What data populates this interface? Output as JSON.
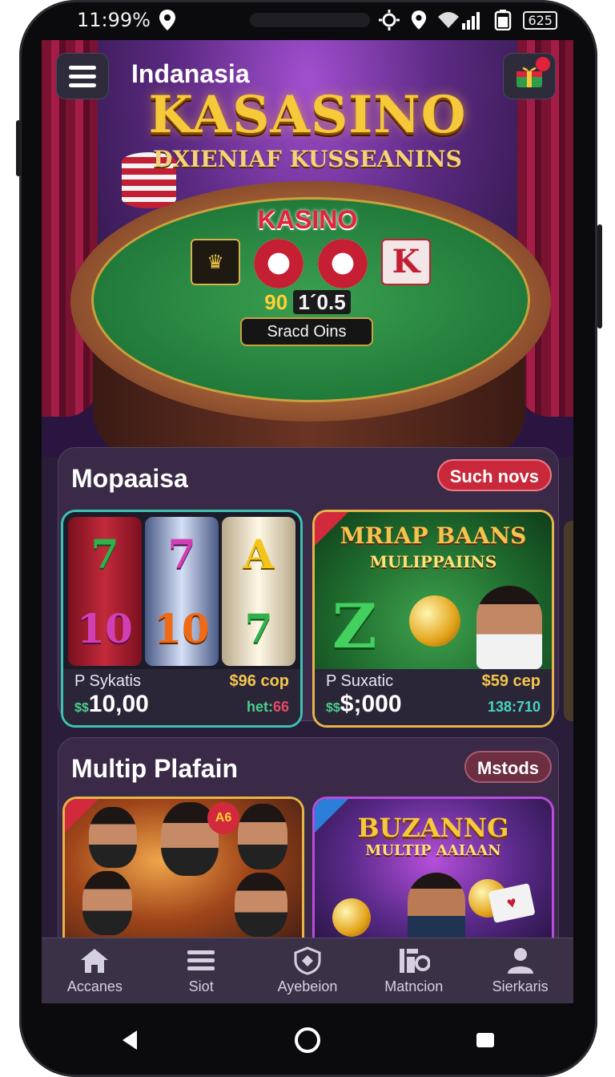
{
  "status_bar": {
    "time": "11:99%",
    "battery": "625"
  },
  "header": {
    "brand": "Indanasia",
    "title": "KASASINO",
    "subtitle": "DXIENIAF KUSSEANINS"
  },
  "hero": {
    "table_logo": "KASINO",
    "score_left": "90",
    "score_right": "1´0.5",
    "start_button": "Sracd Oins",
    "k_card": "K"
  },
  "section1": {
    "title": "Mopaaisa",
    "action": "Such novs",
    "cards": [
      {
        "name": "P Sykatis",
        "price": "$96 cop",
        "amount_prefix": "$$",
        "amount": "10,00",
        "sub": "het:",
        "sub_value": "66",
        "reel_symbols": [
          [
            "7",
            "10"
          ],
          [
            "7",
            "10"
          ],
          [
            "A",
            "7"
          ]
        ]
      },
      {
        "name": "P Suxatic",
        "price": "$59 cep",
        "amount_prefix": "$$",
        "amount": "$;000",
        "sub": "138:710",
        "promo_title": "MRIAP BAANS",
        "promo_sub": "MULIPPAIINS",
        "promo_z": "Z"
      }
    ]
  },
  "section2": {
    "title": "Multip Plafain",
    "action": "Mstods",
    "cards": [
      {
        "badge": "A6"
      },
      {
        "title": "BUZANNG",
        "subtitle": "MULTIP AAIAAN"
      }
    ]
  },
  "bottom_nav": [
    {
      "label": "Accanes",
      "icon": "home-icon"
    },
    {
      "label": "Siot",
      "icon": "list-icon"
    },
    {
      "label": "Ayebeion",
      "icon": "shield-icon"
    },
    {
      "label": "Matncion",
      "icon": "grid-icon"
    },
    {
      "label": "Sierkaris",
      "icon": "user-icon"
    }
  ],
  "colors": {
    "accent_gold": "#f6c93a",
    "accent_red": "#c9283a",
    "section_bg": "#3a2a48",
    "nav_bg": "#3a3147"
  }
}
